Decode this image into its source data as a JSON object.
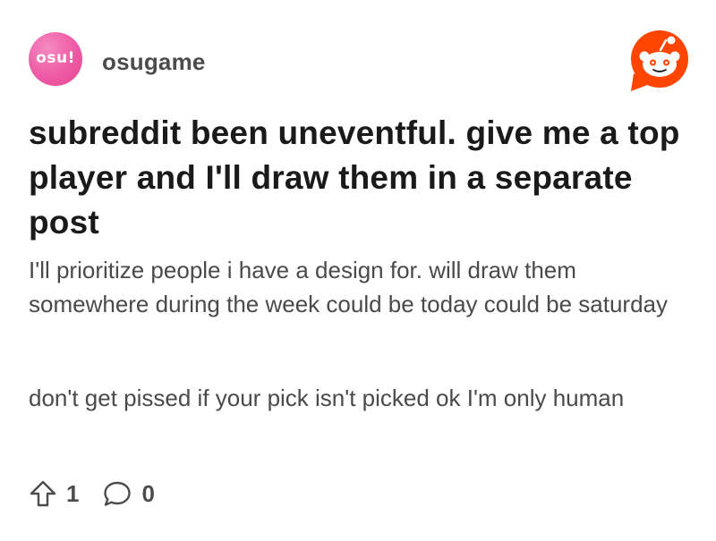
{
  "subreddit": {
    "icon_text": "osu!",
    "name": "osugame",
    "icon_color": "#ee5aa6"
  },
  "brand": {
    "logo": "reddit-snoo-icon",
    "color": "#ff4500"
  },
  "post": {
    "title": "subreddit been uneventful. give me a top player and I'll draw them in a separate post",
    "body_paragraph_1": "I'll prioritize people i have a design for. will draw them somewhere during the week could be today could be saturday",
    "body_paragraph_2": "don't get pissed if your pick isn't picked ok I'm only human"
  },
  "footer": {
    "upvote_icon": "upvote-arrow-icon",
    "upvote_count": "1",
    "comment_icon": "comment-bubble-icon",
    "comment_count": "0"
  }
}
